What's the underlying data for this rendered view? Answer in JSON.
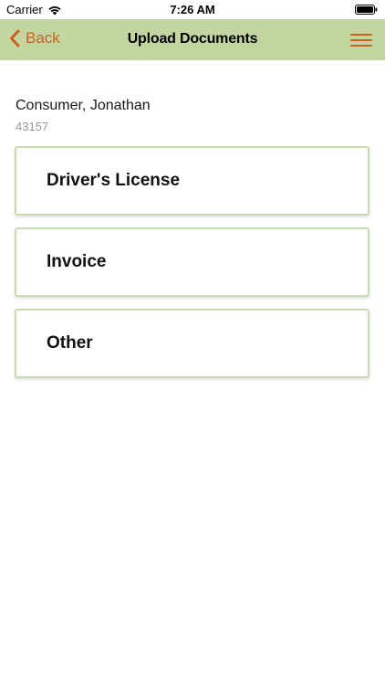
{
  "status_bar": {
    "carrier": "Carrier",
    "time": "7:26 AM",
    "icons": [
      "wifi-icon",
      "battery-icon"
    ]
  },
  "nav": {
    "back_label": "Back",
    "title": "Upload Documents",
    "accent_color": "#c8621e",
    "background_color": "#c3d6a2"
  },
  "customer": {
    "name": "Consumer, Jonathan",
    "id": "43157"
  },
  "documents": [
    {
      "label": "Driver's License"
    },
    {
      "label": "Invoice"
    },
    {
      "label": "Other"
    }
  ]
}
